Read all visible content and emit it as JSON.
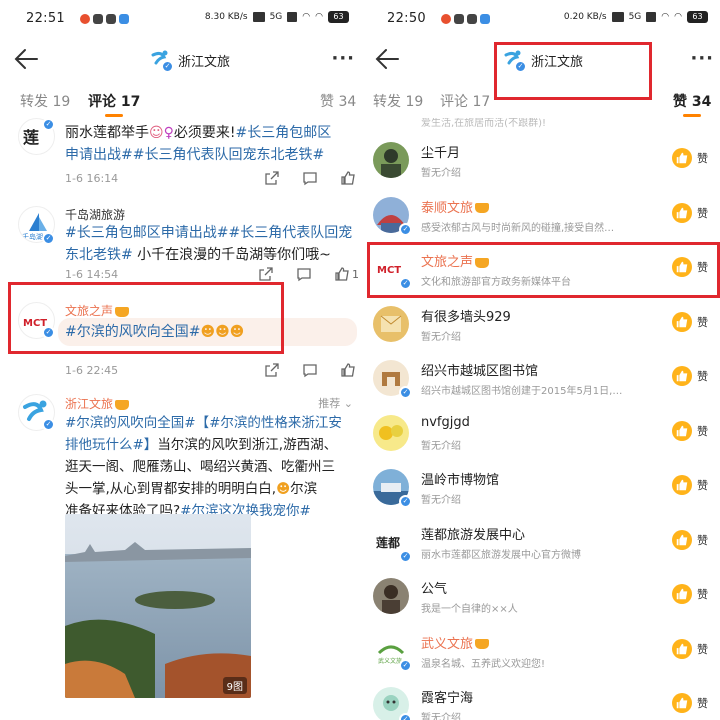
{
  "left": {
    "status": {
      "time": "22:51",
      "net": "8.30 KB/s",
      "sim": "5G",
      "battery": "63"
    },
    "nav": {
      "title": "浙江文旅",
      "more": "···"
    },
    "tabs": {
      "reposts": "转发 19",
      "comments": "评论 17",
      "likes": "赞 34"
    },
    "comment1": {
      "text_pre": "丽水莲都举手",
      "text_mid": "必须要来!",
      "tag1": "#长三角包邮区",
      "tag2": "申请出战#",
      "tag3": "#长三角代表队回宠东北老铁#",
      "date": "1-6 16:14"
    },
    "comment2": {
      "username": "千岛湖旅游",
      "tag1": "#长三角包邮区申请出战#",
      "tag2": "#长三角代表队回宠",
      "tag3": "东北老铁#",
      "text": " 小千在浪漫的千岛湖等你们哦~",
      "date": "1-6 14:54",
      "likes": "1"
    },
    "comment3": {
      "username": "文旅之声",
      "tag": "#尔滨的风吹向全国#",
      "date": "1-6 22:45"
    },
    "post": {
      "username": "浙江文旅",
      "recommend": "推荐",
      "line1_tag": "#尔滨的风吹向全国#",
      "line1_tag2": "【#尔滨的性格来浙江安",
      "line2_tag": "排他玩什么#】",
      "line2": "当尔滨的风吹到浙江,游西湖、",
      "line3": "逛天一阁、爬雁荡山、喝绍兴黄酒、吃衢州三",
      "line4": "头一掌,从心到胃都安排的明明白白,",
      "line4b": "尔滨",
      "line5": "准备好来体验了吗?",
      "line5_tag": "#尔滨这次换我宠你#",
      "image_count": "9图"
    },
    "avatar_labels": {
      "c2": "千岛湖",
      "c3": "MCT"
    }
  },
  "right": {
    "status": {
      "time": "22:50",
      "net": "0.20 KB/s",
      "sim": "5G",
      "battery": "63"
    },
    "nav": {
      "title": "浙江文旅",
      "more": "···"
    },
    "tabs": {
      "reposts": "转发 19",
      "comments": "评论 17",
      "likes": "赞 34"
    },
    "top_partial": "爱生活,在旅居而活(不跟群)!",
    "like_label": "赞",
    "users": [
      {
        "name": "尘千月",
        "desc": "暂无介绍",
        "orange": false,
        "crown": false,
        "verified": false,
        "color": "#4a6a3a"
      },
      {
        "name": "泰顺文旅",
        "desc": "感受浓郁古风与时尚新风的碰撞,接受自然…",
        "orange": true,
        "crown": true,
        "verified": true,
        "color": "#5a7fb0"
      },
      {
        "name": "文旅之声",
        "desc": "文化和旅游部官方政务新媒体平台",
        "orange": true,
        "crown": true,
        "verified": true,
        "color": "#ffffff"
      },
      {
        "name": "有很多墙头929",
        "desc": "暂无介绍",
        "orange": false,
        "crown": false,
        "verified": false,
        "color": "#d9a24a"
      },
      {
        "name": "绍兴市越城区图书馆",
        "desc": "绍兴市越城区图书馆创建于2015年5月1日,…",
        "orange": false,
        "crown": false,
        "verified": true,
        "color": "#c9a070"
      },
      {
        "name": "nvfgjgd",
        "desc": "暂无介绍",
        "orange": false,
        "crown": false,
        "verified": false,
        "color": "#e8d24a"
      },
      {
        "name": "温岭市博物馆",
        "desc": "暂无介绍",
        "orange": false,
        "crown": false,
        "verified": true,
        "color": "#3a6fa0"
      },
      {
        "name": "莲都旅游发展中心",
        "desc": "丽水市莲都区旅游发展中心官方微博",
        "orange": false,
        "crown": false,
        "verified": true,
        "color": "#ffffff"
      },
      {
        "name": "公气",
        "desc": "我是一个自律的××人",
        "orange": false,
        "crown": false,
        "verified": false,
        "color": "#6a5a4a"
      },
      {
        "name": "武义文旅",
        "desc": "温泉名城、五养武义欢迎您!",
        "orange": true,
        "crown": true,
        "verified": true,
        "color": "#ffffff"
      },
      {
        "name": "霞客宁海",
        "desc": "暂无介绍",
        "orange": false,
        "crown": false,
        "verified": true,
        "color": "#9ad3c0"
      }
    ],
    "avatar_labels": {
      "mct": "MCT",
      "lian": "莲都",
      "wuyi": "武义文旅"
    }
  },
  "colors": {
    "accent": "#ff8200",
    "link": "#2c6aa8",
    "username_orange": "#eb7350",
    "highlight": "#e0282e",
    "like_bg": "#ffb31a"
  }
}
